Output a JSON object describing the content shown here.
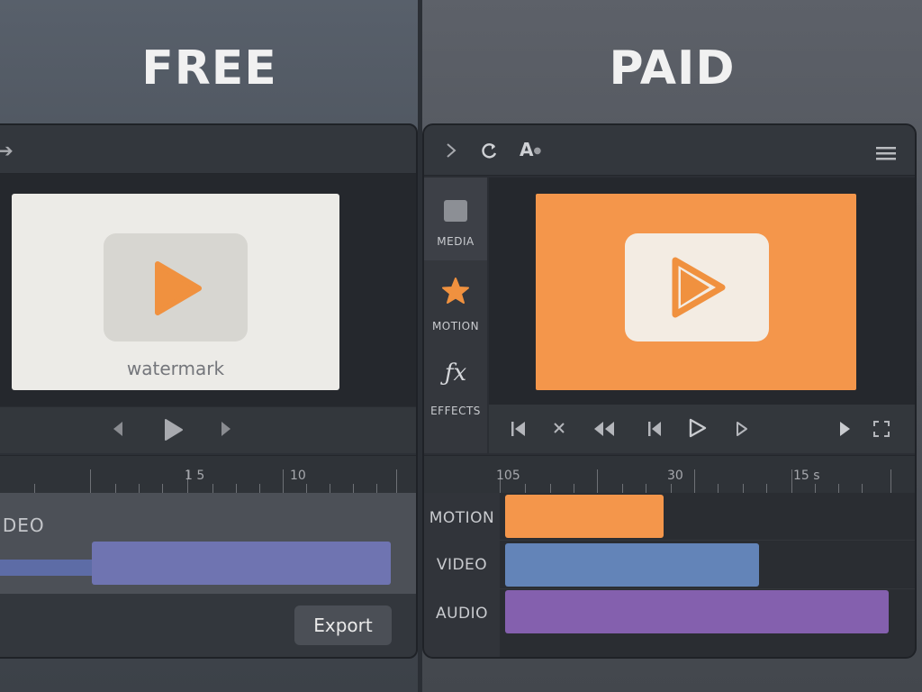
{
  "free": {
    "heading": "FREE",
    "preview": {
      "watermark": "watermark"
    },
    "ruler": {
      "labels": [
        "1 5",
        "10"
      ]
    },
    "track": {
      "label": "IDEO"
    },
    "export_label": "Export",
    "colors": {
      "play": "#f0913f",
      "clip": "#6f74b1"
    }
  },
  "paid": {
    "heading": "PAID",
    "toolbar": {
      "icons": [
        "chevron-right-icon",
        "refresh-icon",
        "text-style-icon",
        "menu-icon"
      ],
      "text_icon": "A"
    },
    "sidebar": [
      {
        "label": "MEDIA",
        "icon": "square-icon"
      },
      {
        "label": "MOTION",
        "icon": "star-icon"
      },
      {
        "label": "EFFECTS",
        "icon": "fx-icon",
        "glyph": "ƒx"
      }
    ],
    "ruler": {
      "labels": [
        "105",
        "30",
        "15 s"
      ]
    },
    "tracks": [
      {
        "label": "MOTION",
        "color": "#f4964b"
      },
      {
        "label": "VIDEO",
        "color": "#6384b8"
      },
      {
        "label": "AUDIO",
        "color": "#8460ae"
      }
    ],
    "colors": {
      "preview": "#f4964b"
    }
  }
}
